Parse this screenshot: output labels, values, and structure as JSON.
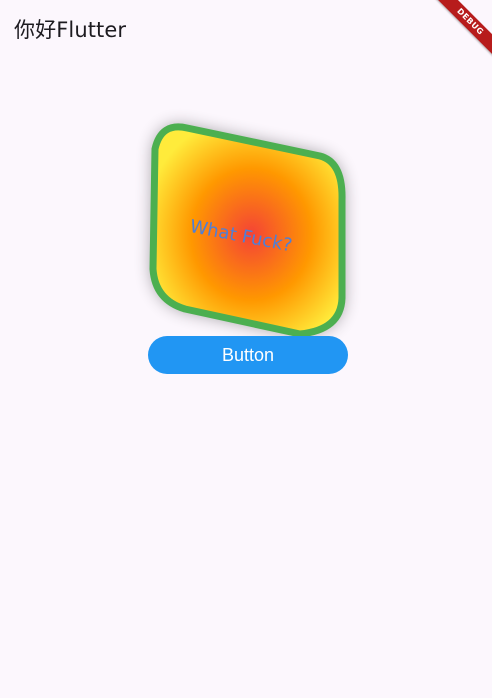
{
  "appbar": {
    "title": "你好Flutter"
  },
  "debug_banner": {
    "label": "DEBUG",
    "color": "#b71c1c"
  },
  "card": {
    "text": "What Fuck?",
    "text_color": "#4f7fd6",
    "border_color": "#4caf50",
    "gradient_center": "#f44336",
    "gradient_edge": "#ffeb3b"
  },
  "button": {
    "label": "Button",
    "color": "#2196f3"
  },
  "colors": {
    "background": "#fcf7fd"
  }
}
